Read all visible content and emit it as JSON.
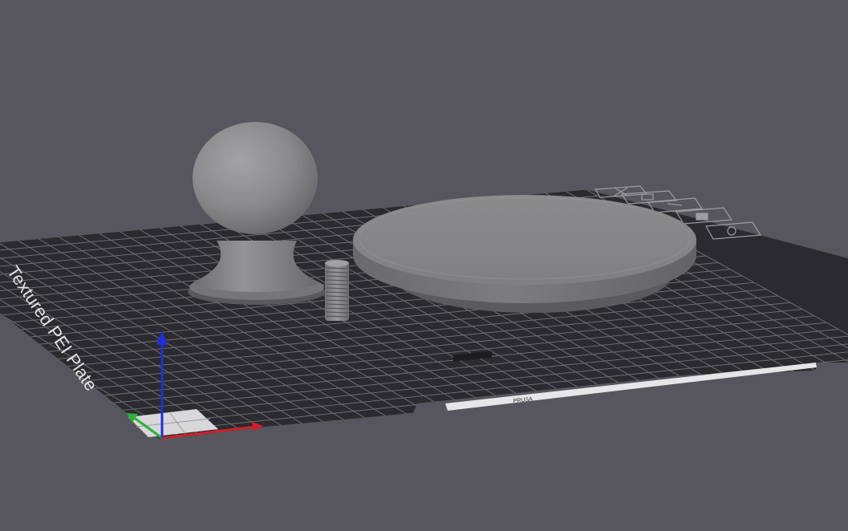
{
  "scene": {
    "background": "#57565e",
    "bed": {
      "surface_label": "Textured PEI Plate",
      "front_strip_label": "PRUSA",
      "bed_color": "#2b2a2e",
      "grid_color": "#8a8990"
    },
    "objects": [
      {
        "name": "ball-knob",
        "color": "#8c8c8f"
      },
      {
        "name": "threaded-rod",
        "color": "#8c8c8f"
      },
      {
        "name": "round-disc",
        "color": "#8c8c8f"
      }
    ],
    "axes": {
      "x_color": "#d0212a",
      "y_color": "#27b43a",
      "z_color": "#1f2fd8"
    },
    "plate_icons": [
      "close-icon",
      "arrange-icon",
      "orient-icon",
      "lock-icon",
      "settings-icon"
    ]
  }
}
